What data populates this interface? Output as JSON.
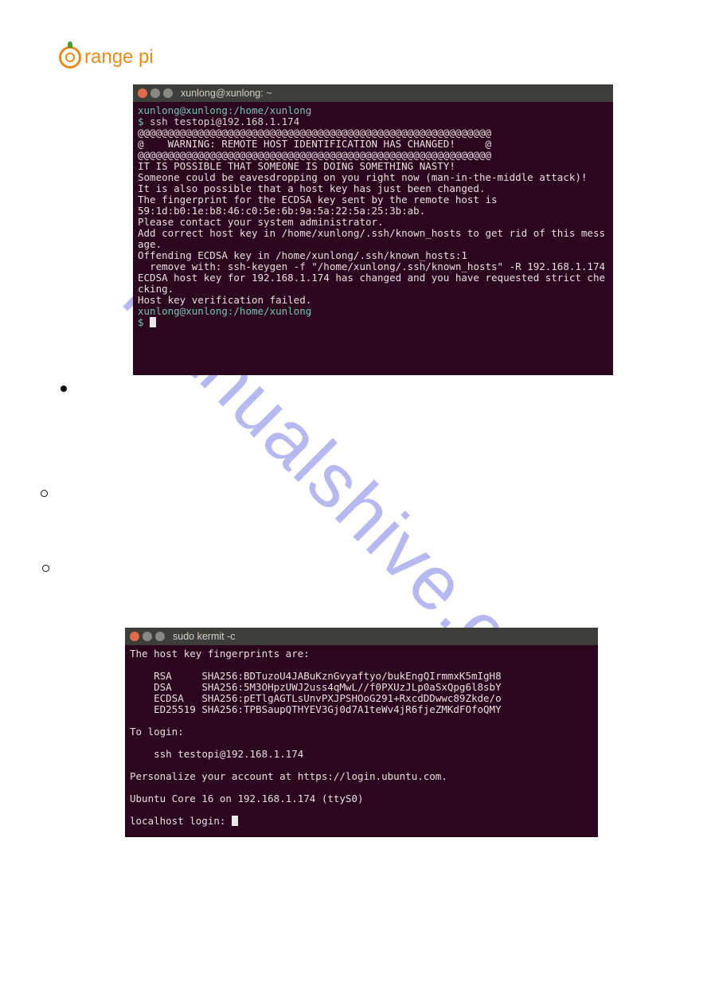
{
  "logo": {
    "text": "range pi"
  },
  "watermark": "manualshive.com",
  "terminal1": {
    "title": "xunlong@xunlong: ~",
    "prompt_path": "xunlong@xunlong:/home/xunlong",
    "prompt_symbol": "$ ",
    "command": "ssh testopi@192.168.1.174",
    "separator1": "@@@@@@@@@@@@@@@@@@@@@@@@@@@@@@@@@@@@@@@@@@@@@@@@@@@@@@@@@@@",
    "warning_line": "@    WARNING: REMOTE HOST IDENTIFICATION HAS CHANGED!     @",
    "separator2": "@@@@@@@@@@@@@@@@@@@@@@@@@@@@@@@@@@@@@@@@@@@@@@@@@@@@@@@@@@@",
    "line_nasty": "IT IS POSSIBLE THAT SOMEONE IS DOING SOMETHING NASTY!",
    "line_eaves": "Someone could be eavesdropping on you right now (man-in-the-middle attack)!",
    "line_also": "It is also possible that a host key has just been changed.",
    "line_fp1": "The fingerprint for the ECDSA key sent by the remote host is",
    "line_fp2": "59:1d:b0:1e:b8:46:c0:5e:6b:9a:5a:22:5a:25:3b:ab.",
    "line_admin": "Please contact your system administrator.",
    "line_add1": "Add correct host key in /home/xunlong/.ssh/known_hosts to get rid of this message.",
    "line_off": "Offending ECDSA key in /home/xunlong/.ssh/known_hosts:1",
    "line_remove": "  remove with: ssh-keygen -f \"/home/xunlong/.ssh/known_hosts\" -R 192.168.1.174",
    "line_changed": "ECDSA host key for 192.168.1.174 has changed and you have requested strict checking.",
    "line_fail": "Host key verification failed."
  },
  "terminal2": {
    "title": "sudo kermit -c",
    "line_fp_are": "The host key fingerprints are:",
    "line_rsa": "    RSA     SHA256:BDTuzoU4JABuKznGvyaftyo/bukEngQIrmmxK5mIgH8",
    "line_dsa": "    DSA     SHA256:5M3OHpzUWJ2uss4qMwL//f0PXUzJLp0aSxQpg6l8sbY",
    "line_ecdsa": "    ECDSA   SHA256:pETlgAGTLsUnvPXJPSHOoG291+RxcdDDwwc89Zkde/o",
    "line_ed": "    ED25519 SHA256:TPBSaupQTHYEV3Gj0d7A1teWv4jR6fjeZMKdFOfoQMY",
    "line_login": "To login:",
    "line_ssh": "    ssh testopi@192.168.1.174",
    "line_pers": "Personalize your account at https://login.ubuntu.com.",
    "line_core": "Ubuntu Core 16 on 192.168.1.174 (ttyS0)",
    "line_local": "localhost login: "
  }
}
